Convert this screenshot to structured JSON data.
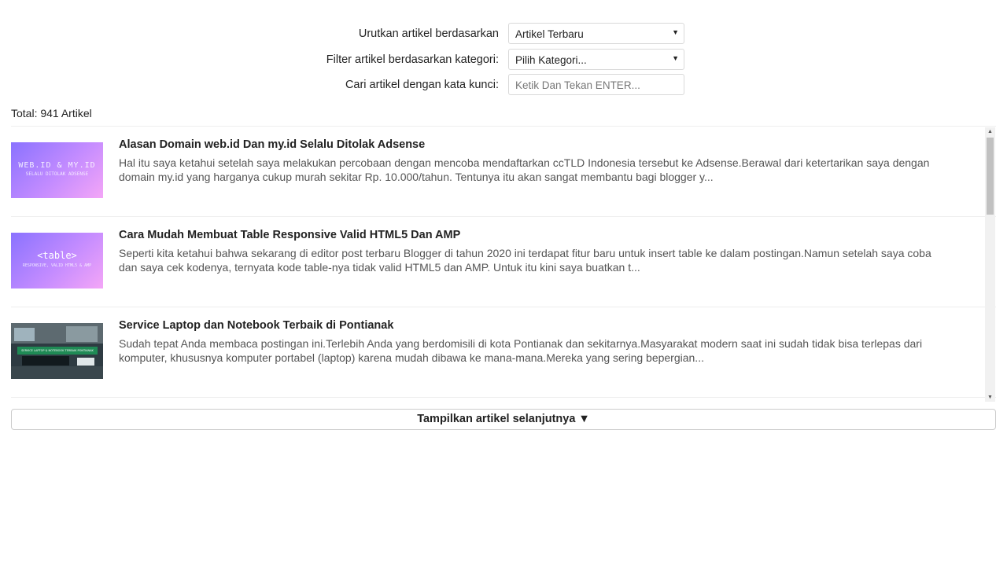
{
  "filters": {
    "sort_label": "Urutkan artikel berdasarkan",
    "sort_value": "Artikel Terbaru",
    "category_label": "Filter artikel berdasarkan kategori:",
    "category_value": "Pilih Kategori...",
    "search_label": "Cari artikel dengan kata kunci:",
    "search_placeholder": "Ketik Dan Tekan ENTER..."
  },
  "total": "Total: 941 Artikel",
  "articles": [
    {
      "title": "Alasan Domain web.id Dan my.id Selalu Ditolak Adsense",
      "excerpt_line1": "Hal itu saya ketahui setelah saya melakukan percobaan dengan mencoba mendaftarkan ccTLD Indonesia tersebut ke Adsense.Berawal dari ketertarikan saya dengan",
      "excerpt_line2": "domain my.id yang harganya cukup murah sekitar Rp. 10.000/tahun. Tentunya itu akan sangat membantu bagi blogger y...",
      "thumb_text1": "WEB.ID & MY.ID",
      "thumb_text2": "SELALU DITOLAK ADSENSE"
    },
    {
      "title": "Cara Mudah Membuat Table Responsive Valid HTML5 Dan AMP",
      "excerpt_line1": "Seperti kita ketahui bahwa sekarang di editor post terbaru Blogger di tahun 2020 ini terdapat fitur baru untuk insert table ke dalam postingan.Namun setelah saya coba",
      "excerpt_line2": "dan saya cek kodenya, ternyata kode table-nya tidak valid HTML5 dan AMP. Untuk itu kini saya buatkan t...",
      "thumb_text1": "<table>",
      "thumb_text2": "RESPONSIVE, VALID HTML5 & AMP"
    },
    {
      "title": "Service Laptop dan Notebook Terbaik di Pontianak",
      "excerpt_line1": "Sudah tepat Anda membaca postingan ini.Terlebih Anda yang berdomisili di kota Pontianak dan sekitarnya.Masyarakat modern saat ini sudah tidak bisa terlepas dari",
      "excerpt_line2": "komputer, khususnya komputer portabel (laptop) karena mudah dibawa ke mana-mana.Mereka yang sering bepergian...",
      "thumb_text1": "SERVICE LAPTOP & NOTEBOOK TERBAIK PONTIANAK"
    }
  ],
  "load_more_label": "Tampilkan artikel selanjutnya ▼",
  "icons": {
    "dropdown": "▼",
    "scroll_up": "▲",
    "scroll_down": "▼"
  }
}
